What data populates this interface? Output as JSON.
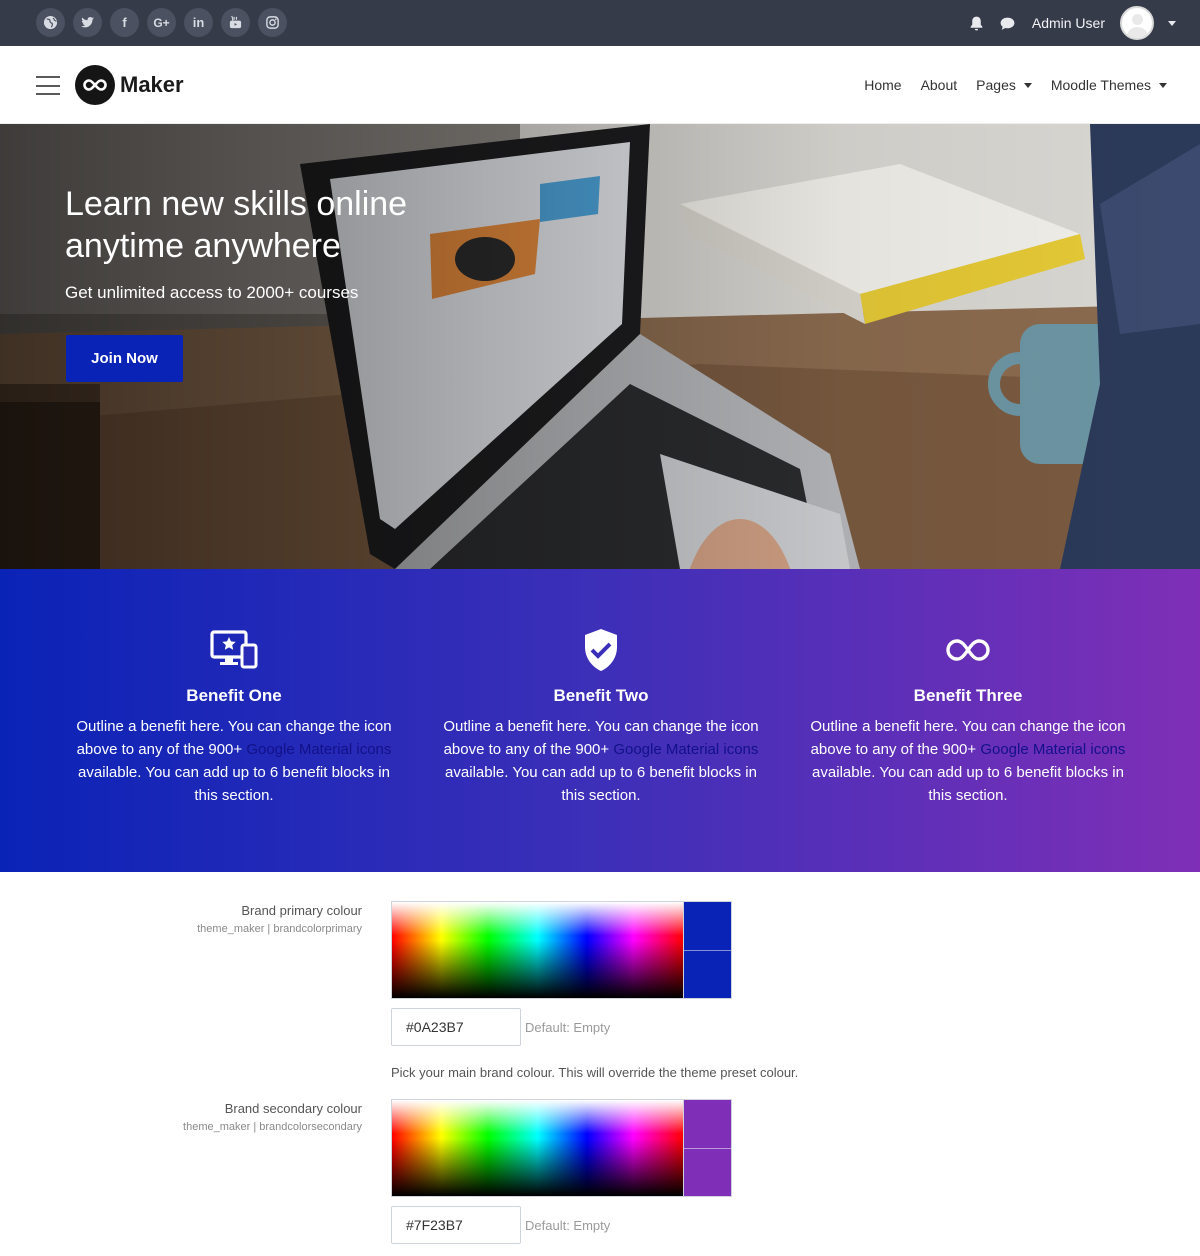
{
  "topbar": {
    "social": [
      {
        "name": "globe-icon"
      },
      {
        "name": "twitter-icon"
      },
      {
        "name": "facebook-icon",
        "glyph": "f"
      },
      {
        "name": "google-plus-icon",
        "glyph": "G+"
      },
      {
        "name": "linkedin-icon",
        "glyph": "in"
      },
      {
        "name": "youtube-icon"
      },
      {
        "name": "instagram-icon"
      }
    ],
    "user_name": "Admin User"
  },
  "navbar": {
    "brand": "Maker",
    "links": [
      {
        "label": "Home",
        "dropdown": false
      },
      {
        "label": "About",
        "dropdown": false
      },
      {
        "label": "Pages",
        "dropdown": true
      },
      {
        "label": "Moodle Themes",
        "dropdown": true
      }
    ]
  },
  "hero": {
    "title": "Learn new skills online anytime anywhere",
    "subtitle": "Get unlimited access to 2000+ courses",
    "button": "Join Now"
  },
  "benefits": [
    {
      "icon": "devices-star-icon",
      "title": "Benefit One",
      "text_before": "Outline a benefit here. You can change the icon above to any of the 900+ ",
      "link": "Google Material icons",
      "text_after": " available. You can add up to 6 benefit blocks in this section."
    },
    {
      "icon": "shield-check-icon",
      "title": "Benefit Two",
      "text_before": "Outline a benefit here. You can change the icon above to any of the 900+ ",
      "link": "Google Material icons",
      "text_after": " available. You can add up to 6 benefit blocks in this section."
    },
    {
      "icon": "infinity-icon",
      "title": "Benefit Three",
      "text_before": "Outline a benefit here. You can change the icon above to any of the 900+ ",
      "link": "Google Material icons",
      "text_after": " available. You can add up to 6 benefit blocks in this section."
    }
  ],
  "settings": [
    {
      "label": "Brand primary colour",
      "key": "theme_maker | brandcolorprimary",
      "value": "#0A23B7",
      "default": "Default: Empty",
      "description": "Pick your main brand colour. This will override the theme preset colour.",
      "swatch": "#0a23b7"
    },
    {
      "label": "Brand secondary colour",
      "key": "theme_maker | brandcolorsecondary",
      "value": "#7F23B7",
      "default": "Default: Empty",
      "swatch": "#7f2fb7"
    }
  ],
  "colors": {
    "topbar": "#363b4a",
    "primary": "#0a23b7",
    "secondary": "#7f2fb7"
  }
}
